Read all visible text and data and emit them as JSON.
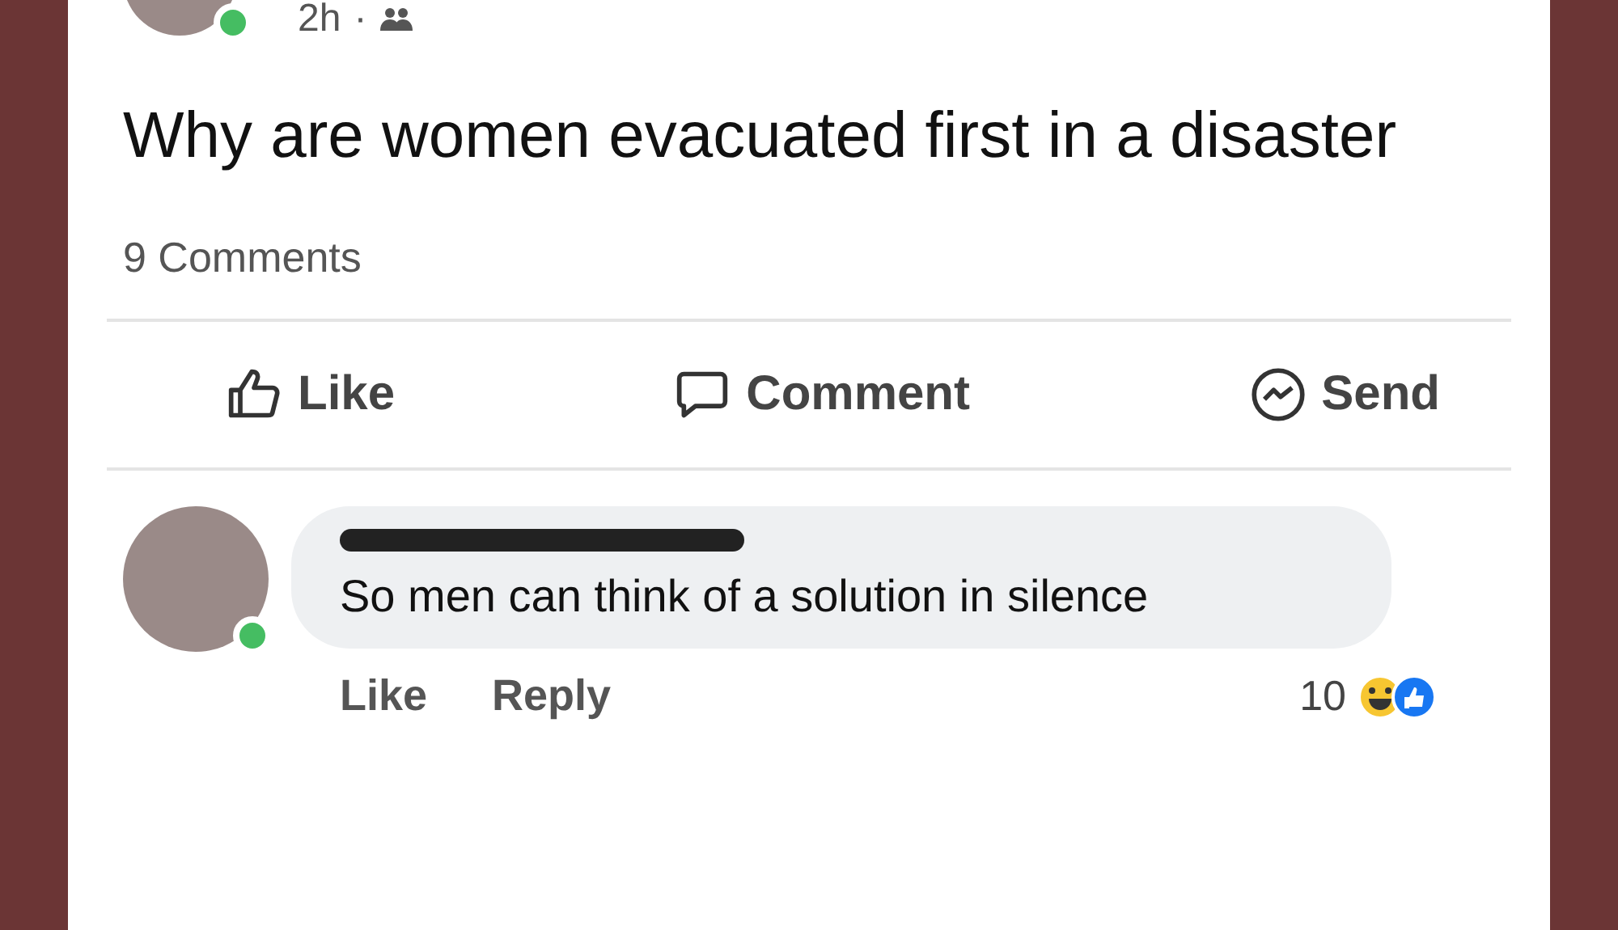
{
  "post": {
    "author_online": true,
    "time": "2h",
    "separator": "·",
    "text": "Why are women evacuated first in a disaster",
    "comment_count": "9 Comments"
  },
  "actions": [
    {
      "label": "Like",
      "kind": "like"
    },
    {
      "label": "Comment",
      "kind": "comment"
    },
    {
      "label": "Send",
      "kind": "send"
    }
  ],
  "comment": {
    "author_online": true,
    "text": "So men can think of a solution in silence",
    "links": [
      "Like",
      "Reply"
    ],
    "reaction_count": "10"
  }
}
